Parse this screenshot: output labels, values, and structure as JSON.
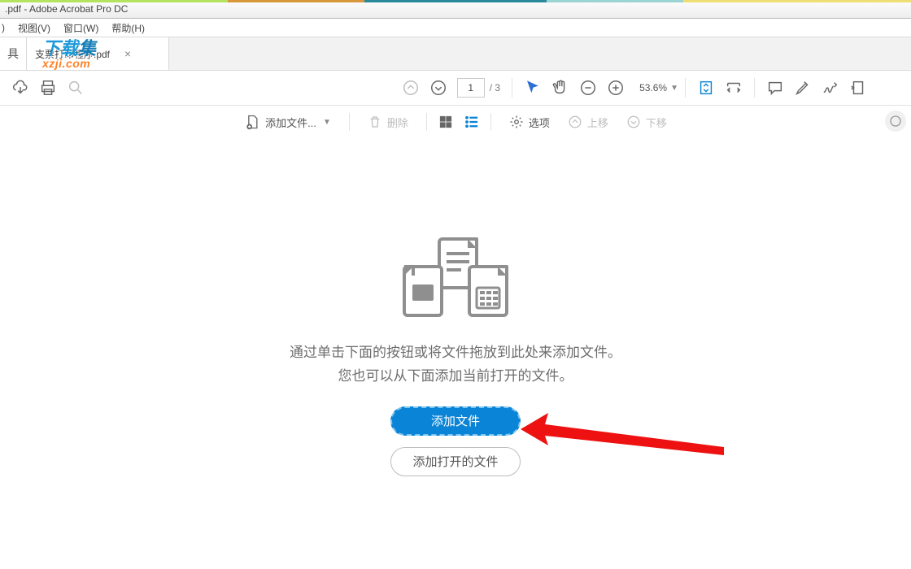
{
  "window": {
    "title": ".pdf - Adobe Acrobat Pro DC"
  },
  "menu": {
    "truncated": ")",
    "view": "视图(V)",
    "window": "窗口(W)",
    "help": "帮助(H)"
  },
  "tabs": {
    "left_label": "具",
    "file_name": "支票打印程序.pdf"
  },
  "watermark": {
    "line1_a": "下载",
    "line1_b": "集",
    "line2": "xzji.com"
  },
  "toolbar": {
    "page_current": "1",
    "page_total": "/ 3",
    "zoom_value": "53.6%"
  },
  "toolbar2": {
    "add_files": "添加文件...",
    "delete": "删除",
    "options": "选项",
    "move_up": "上移",
    "move_down": "下移"
  },
  "empty": {
    "line1": "通过单击下面的按钮或将文件拖放到此处来添加文件。",
    "line2": "您也可以从下面添加当前打开的文件。",
    "btn_add": "添加文件",
    "btn_add_open": "添加打开的文件"
  }
}
